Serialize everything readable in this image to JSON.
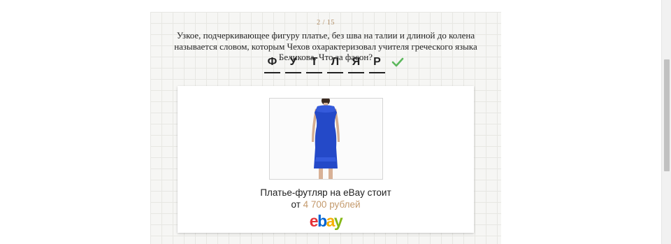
{
  "quiz": {
    "counter": "2 / 15",
    "question": "Узкое, подчеркивающее фигуру платье, без шва на талии и длиной до колена называется словом, которым Чехов охарактеризовал учителя греческого языка Беликова. Что за фасон?",
    "answer_letters": [
      "Ф",
      "У",
      "Т",
      "Л",
      "Я",
      "Р"
    ],
    "status_icon": "checkmark-icon",
    "status_color": "#5cb85c"
  },
  "card": {
    "image_icon": "blue-sheath-dress-photo",
    "caption_line1": "Платье-футляр на eBay стоит",
    "caption_prefix": "от",
    "price": "4 700 рублей",
    "price_color": "#c49a6c",
    "logo_letters": [
      "e",
      "b",
      "a",
      "y"
    ],
    "logo_colors": [
      "#e53238",
      "#0064d2",
      "#f5af02",
      "#86b817"
    ]
  }
}
